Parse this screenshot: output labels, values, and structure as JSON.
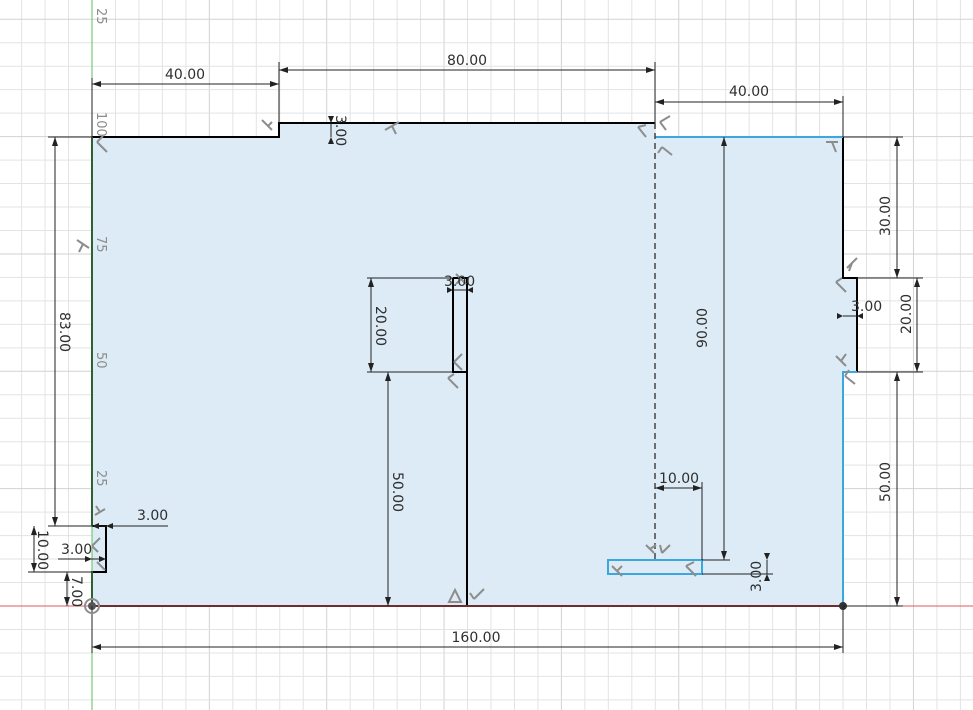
{
  "canvas": {
    "name": "sketch-canvas",
    "background_color": "#ffffff",
    "grid_color": "#e3e3e3",
    "major_grid_color": "#d2d2d2",
    "profile_fill": "#dcebf5",
    "line_color": "#000000",
    "selected_line_color": "#3aa7dd",
    "x_axis_color": "#e05a5a",
    "y_axis_color": "#5cc25c"
  },
  "ruler_labels": [
    "25",
    "100",
    "75",
    "50",
    "25"
  ],
  "dimensions": [
    "40.00",
    "80.00",
    "40.00",
    "3.00",
    "83.00",
    "3.00",
    "10.00",
    "3.00",
    "7.00",
    "20.00",
    "3.00",
    "50.00",
    "90.00",
    "10.00",
    "3.00",
    "30.00",
    "20.00",
    "3.00",
    "50.00",
    "160.00"
  ],
  "constraint_icons": [
    "coincident-icon",
    "horizontal-icon",
    "perpendicular-icon",
    "tangent-icon"
  ]
}
